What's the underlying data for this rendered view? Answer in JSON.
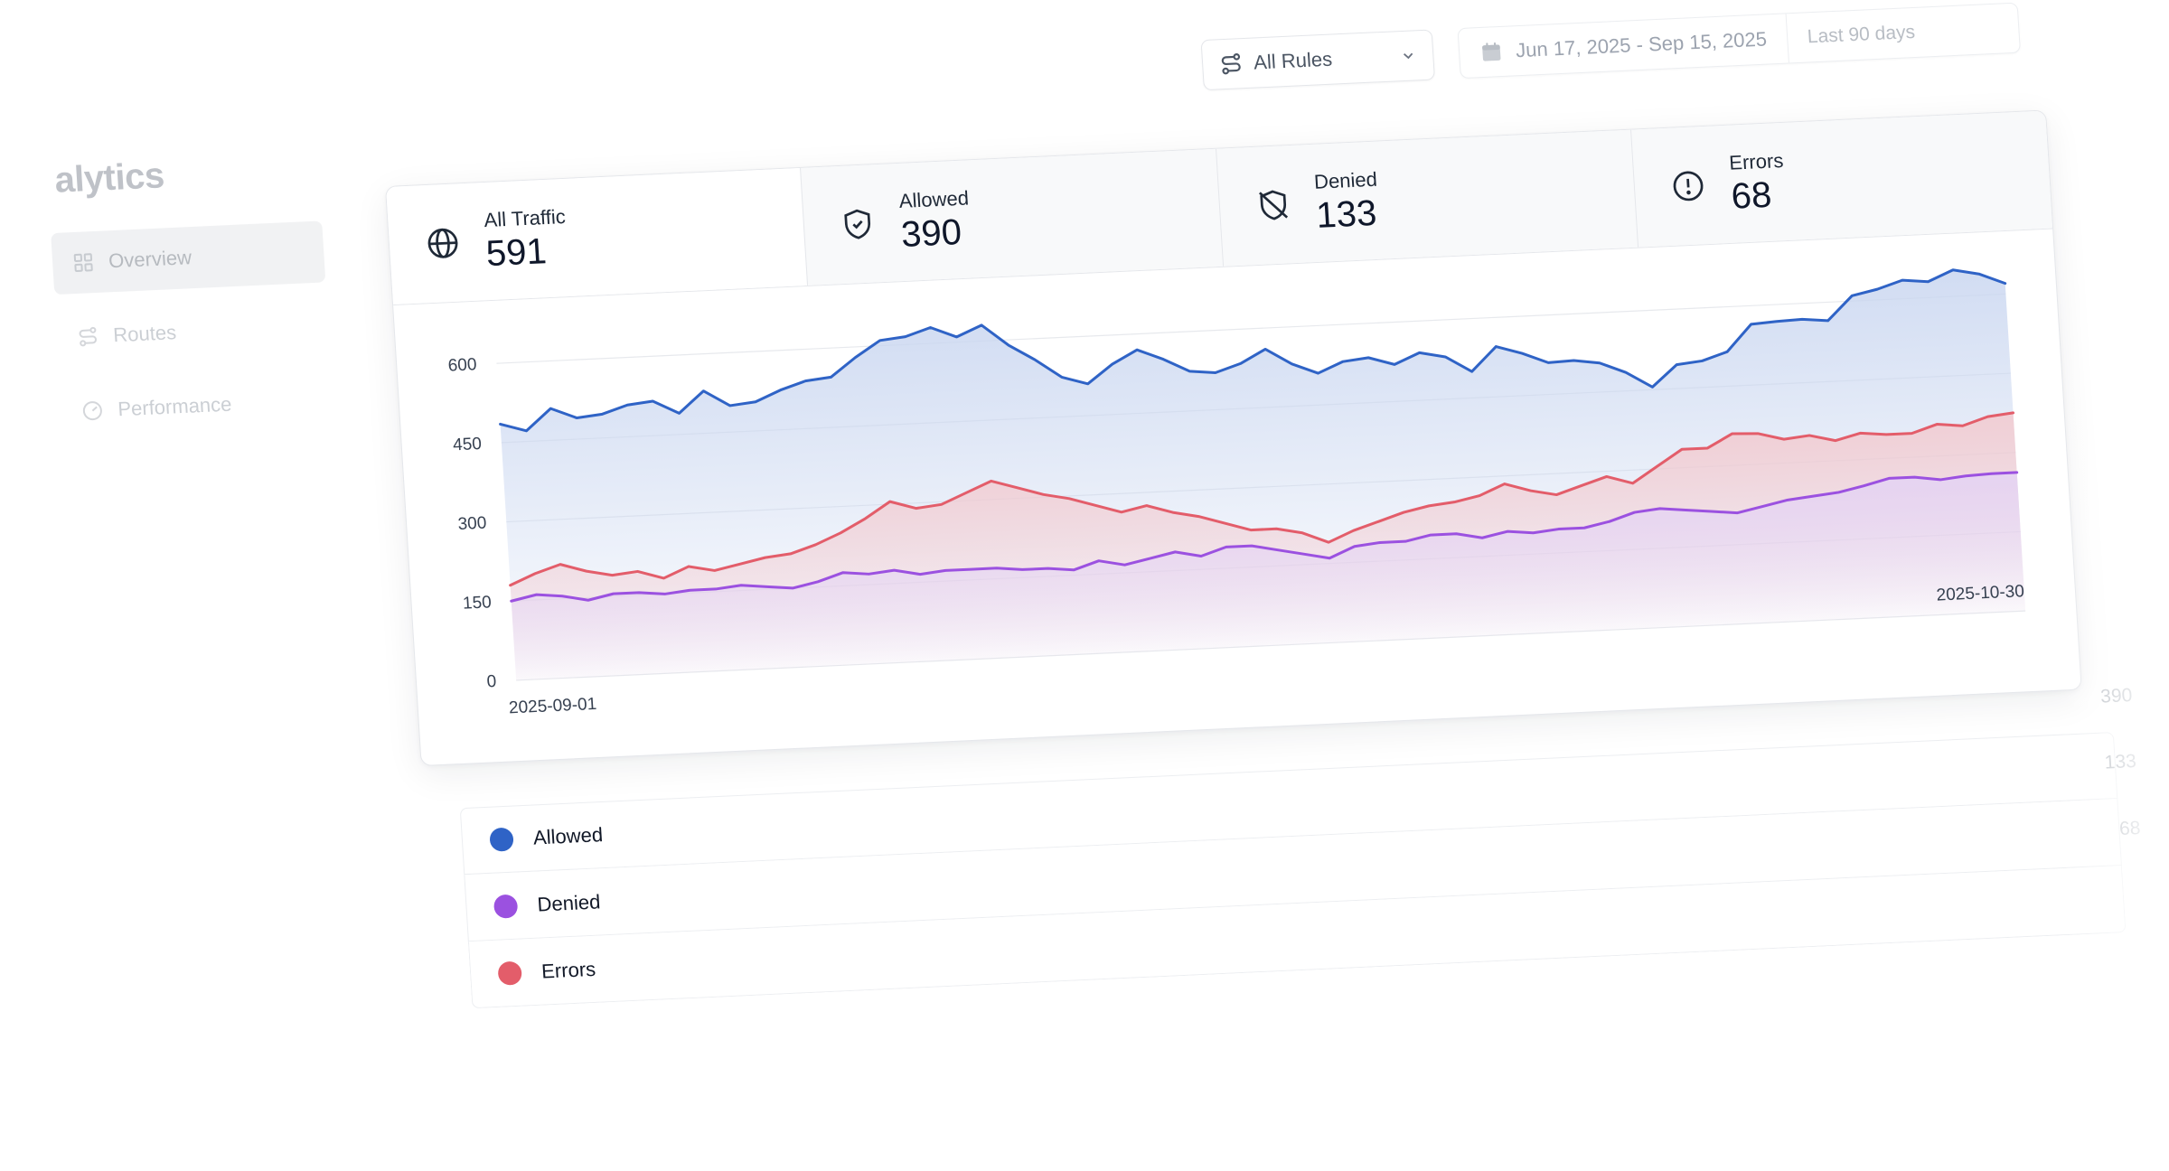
{
  "app": {
    "title": "alytics"
  },
  "sidebar": {
    "items": [
      {
        "label": "Overview",
        "icon": "grid-icon",
        "active": true
      },
      {
        "label": "Routes",
        "icon": "route-icon",
        "active": false
      },
      {
        "label": "Performance",
        "icon": "gauge-icon",
        "active": false
      }
    ]
  },
  "toolbar": {
    "rules_select": {
      "label": "All Rules",
      "icon": "route-icon"
    },
    "date_range": {
      "label": "Jun 17, 2025 - Sep 15, 2025",
      "icon": "calendar-icon"
    },
    "preset": "Last 90 days"
  },
  "tabs": [
    {
      "label": "All Traffic",
      "value": "591",
      "icon": "globe-icon",
      "active": true
    },
    {
      "label": "Allowed",
      "value": "390",
      "icon": "shield-check-icon",
      "active": false
    },
    {
      "label": "Denied",
      "value": "133",
      "icon": "shield-off-icon",
      "active": false
    },
    {
      "label": "Errors",
      "value": "68",
      "icon": "alert-circle-icon",
      "active": false
    }
  ],
  "legend": [
    {
      "name": "Allowed",
      "value": "390",
      "color": "#2f63c6"
    },
    {
      "name": "Denied",
      "value": "133",
      "color": "#9b51e0"
    },
    {
      "name": "Errors",
      "value": "68",
      "color": "#e35d6a"
    }
  ],
  "colors": {
    "allowed": "#2f63c6",
    "denied": "#9b51e0",
    "errors": "#e35d6a",
    "allowed_fill": "#c9d6f0",
    "errors_fill": "#f3c9ce"
  },
  "chart_data": {
    "type": "area",
    "x_start": "2025-09-01",
    "x_end": "2025-10-30",
    "x_tick_labels": [
      "2025-09-01",
      "2025-10-30"
    ],
    "y_ticks": [
      0,
      150,
      300,
      450,
      600
    ],
    "ylim": [
      0,
      650
    ],
    "grid": true,
    "series": [
      {
        "name": "Allowed",
        "color": "#2f63c6",
        "values": [
          485,
          470,
          510,
          490,
          495,
          510,
          515,
          490,
          530,
          500,
          505,
          525,
          540,
          545,
          580,
          610,
          615,
          630,
          610,
          630,
          590,
          560,
          525,
          510,
          545,
          570,
          550,
          525,
          520,
          535,
          560,
          530,
          510,
          530,
          535,
          520,
          540,
          530,
          500,
          545,
          530,
          510,
          512,
          505,
          485,
          455,
          495,
          500,
          515,
          565,
          568,
          570,
          565,
          610,
          620,
          635,
          630,
          650,
          640,
          620
        ]
      },
      {
        "name": "Errors",
        "color": "#e35d6a",
        "values": [
          180,
          200,
          215,
          200,
          190,
          195,
          180,
          200,
          190,
          200,
          210,
          215,
          230,
          250,
          275,
          305,
          290,
          295,
          315,
          335,
          320,
          305,
          295,
          280,
          265,
          275,
          260,
          250,
          235,
          220,
          220,
          210,
          190,
          210,
          225,
          240,
          250,
          255,
          265,
          285,
          270,
          260,
          275,
          290,
          275,
          305,
          335,
          335,
          360,
          358,
          345,
          350,
          338,
          350,
          345,
          345,
          360,
          355,
          370,
          375
        ]
      },
      {
        "name": "Denied",
        "color": "#9b51e0",
        "values": [
          150,
          160,
          155,
          145,
          155,
          155,
          150,
          155,
          155,
          160,
          155,
          150,
          160,
          175,
          170,
          175,
          165,
          170,
          170,
          170,
          165,
          165,
          160,
          175,
          165,
          175,
          185,
          175,
          190,
          190,
          180,
          170,
          160,
          180,
          185,
          185,
          195,
          195,
          185,
          195,
          190,
          195,
          195,
          205,
          220,
          225,
          220,
          215,
          210,
          220,
          230,
          235,
          240,
          250,
          262,
          262,
          255,
          260,
          262,
          262
        ]
      }
    ]
  }
}
